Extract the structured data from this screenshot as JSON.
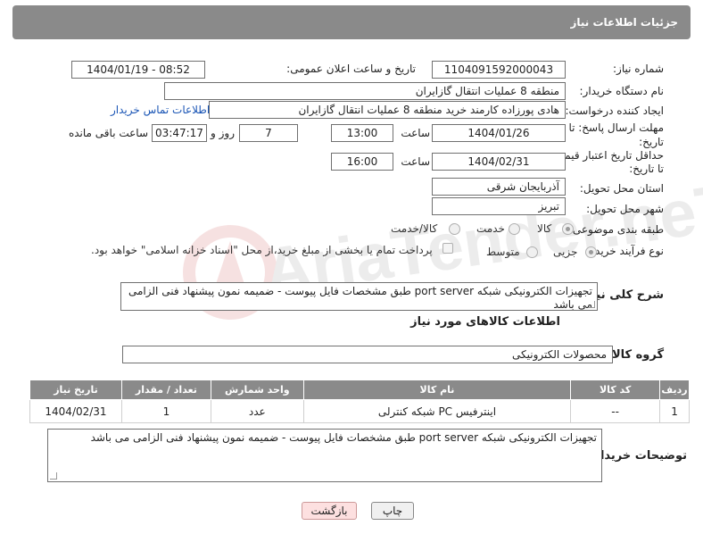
{
  "header": {
    "title": "جزئیات اطلاعات نیاز"
  },
  "form": {
    "need_number_label": "شماره نیاز:",
    "need_number": "1104091592000043",
    "announce_label": "تاریخ و ساعت اعلان عمومی:",
    "announce_value": "1404/01/19 - 08:52",
    "buyer_org_label": "نام دستگاه خریدار:",
    "buyer_org": "منطقه 8 عملیات انتقال گازایران",
    "creator_label": "ایجاد کننده درخواست:",
    "creator": "هادی پورزاده کارمند خرید منطقه 8 عملیات انتقال گازایران",
    "contact_link": "اطلاعات تماس خریدار",
    "deadline_label_1": "مهلت ارسال پاسخ: تا",
    "deadline_label_2": "تاریخ:",
    "deadline_date": "1404/01/26",
    "time_label": "ساعت",
    "deadline_time": "13:00",
    "days_value": "7",
    "days_label": "روز و",
    "remaining_time": "03:47:17",
    "remaining_label": "ساعت باقی مانده",
    "price_label_1": "حداقل تاریخ اعتبار قیمت:",
    "price_label_2": "تا تاریخ:",
    "price_date": "1404/02/31",
    "price_time": "16:00",
    "province_label": "استان محل تحویل:",
    "province": "آذربایجان شرقی",
    "city_label": "شهر محل تحویل:",
    "city": "تبریز",
    "category_label": "طبقه بندی موضوعی:",
    "category_options": [
      "کالا",
      "خدمت",
      "کالا/خدمت"
    ],
    "process_label": "نوع فرآیند خرید :",
    "process_options": [
      "جزیی",
      "متوسط"
    ],
    "payment_note": "پرداخت تمام یا بخشی از مبلغ خرید،از محل \"اسناد خزانه اسلامی\" خواهد بود.",
    "description_label": "شرح کلی نیاز:",
    "description": "تجهیزات الکترونیکی شبکه  port server طبق مشخصات فایل پیوست - ضمیمه نمون پیشنهاد فنی الزامی می باشد"
  },
  "goods": {
    "section_title": "اطلاعات کالاهای مورد نیاز",
    "group_label": "گروه کالا:",
    "group_value": "محصولات الکترونیکی",
    "columns": [
      "ردیف",
      "کد کالا",
      "نام کالا",
      "واحد شمارش",
      "تعداد / مقدار",
      "تاریخ نیاز"
    ],
    "rows": [
      [
        "1",
        "--",
        "اینترفیس PC شبکه کنترلی",
        "عدد",
        "1",
        "1404/02/31"
      ]
    ]
  },
  "buyer_notes": {
    "label": "توضیحات خریدار:",
    "text": "تجهیزات الکترونیکی شبکه  port server طبق مشخصات فایل پیوست - ضمیمه نمون پیشنهاد فنی الزامی می باشد"
  },
  "buttons": {
    "print": "چاپ",
    "back": "بازگشت"
  },
  "colors": {
    "header_bg": "#8a8a8a",
    "link": "#1a55b5",
    "back_button": "#fde0e0"
  },
  "watermark": {
    "text": "AriaTender.neT"
  }
}
